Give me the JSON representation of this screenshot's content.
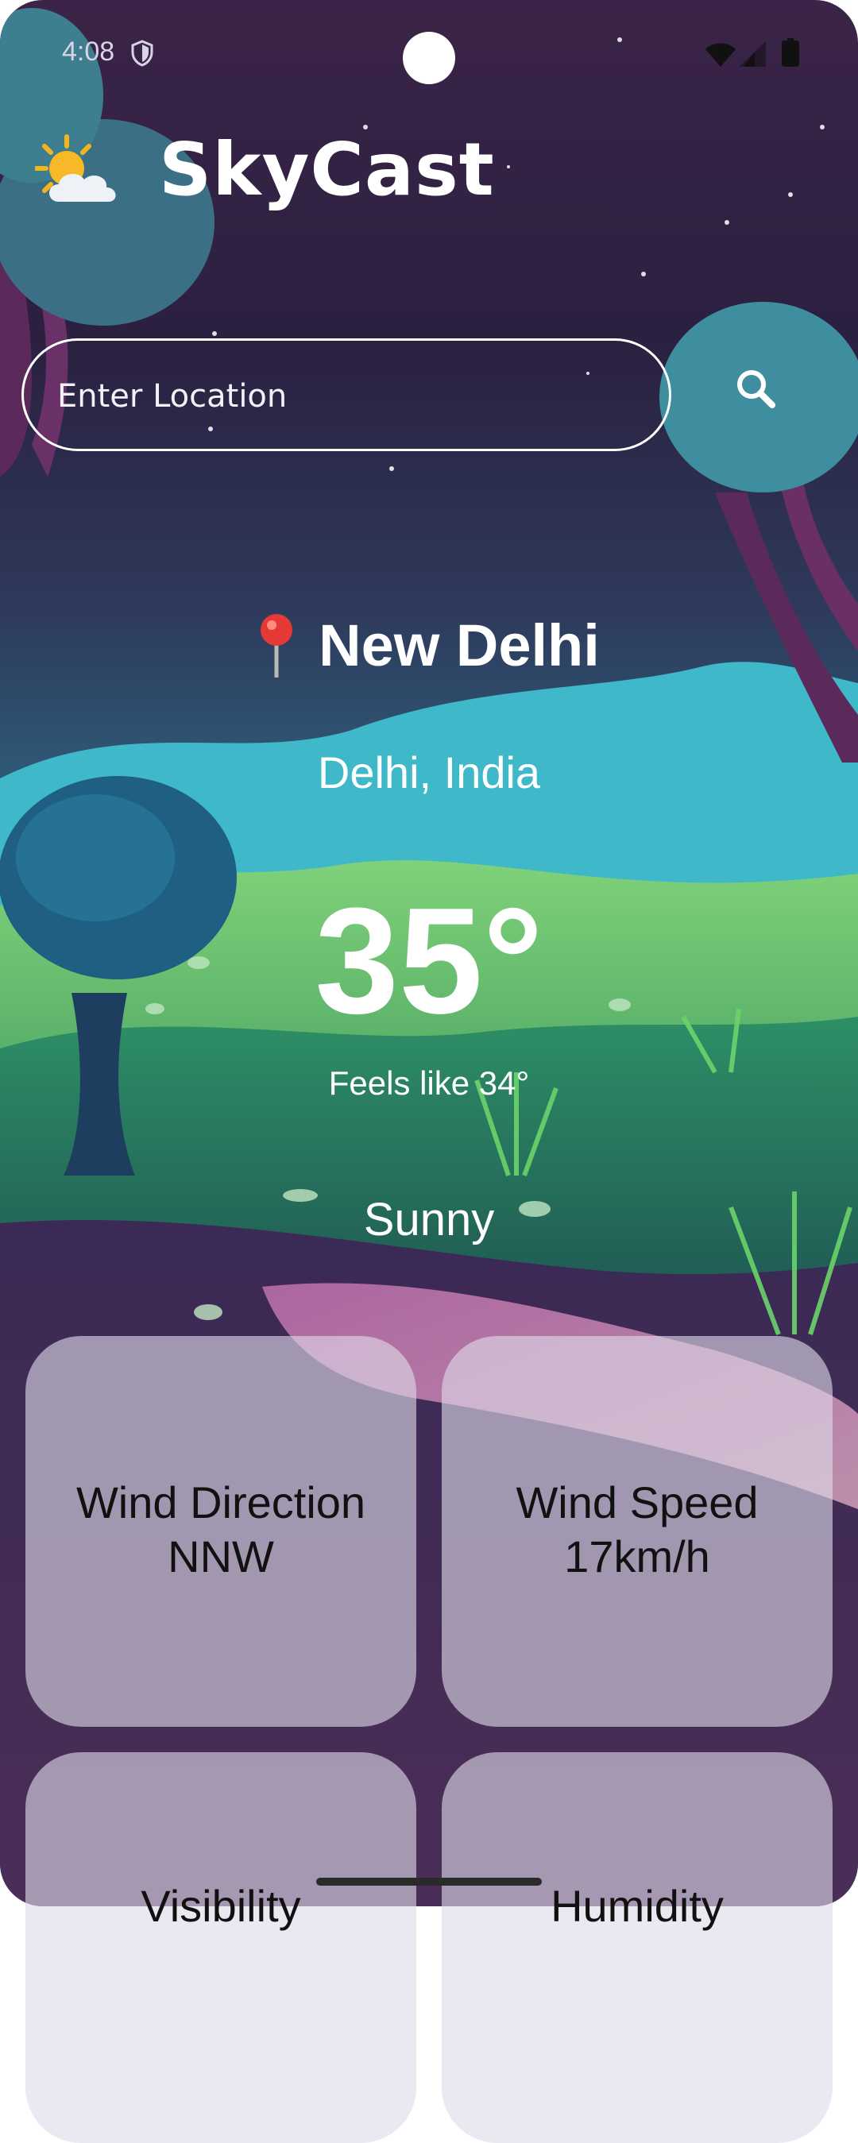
{
  "status_bar": {
    "time": "4:08"
  },
  "app": {
    "title": "SkyCast",
    "logo_icon": "sun-behind-cloud-icon"
  },
  "search": {
    "placeholder": "Enter Location",
    "value": ""
  },
  "location": {
    "city": "New Delhi",
    "region": "Delhi, India"
  },
  "weather": {
    "temperature": "35°",
    "feels_like": "Feels like 34°",
    "condition": "Sunny"
  },
  "cards": [
    {
      "label": "Wind Direction",
      "value": "NNW"
    },
    {
      "label": "Wind Speed",
      "value": "17km/h"
    },
    {
      "label": "Visibility",
      "value": ""
    },
    {
      "label": "Humidity",
      "value": ""
    }
  ],
  "colors": {
    "sky_top": "#3a2648",
    "sky_mid": "#2c4a6a",
    "hill_green": "#58b852",
    "accent_teal": "#3fc4d8"
  }
}
